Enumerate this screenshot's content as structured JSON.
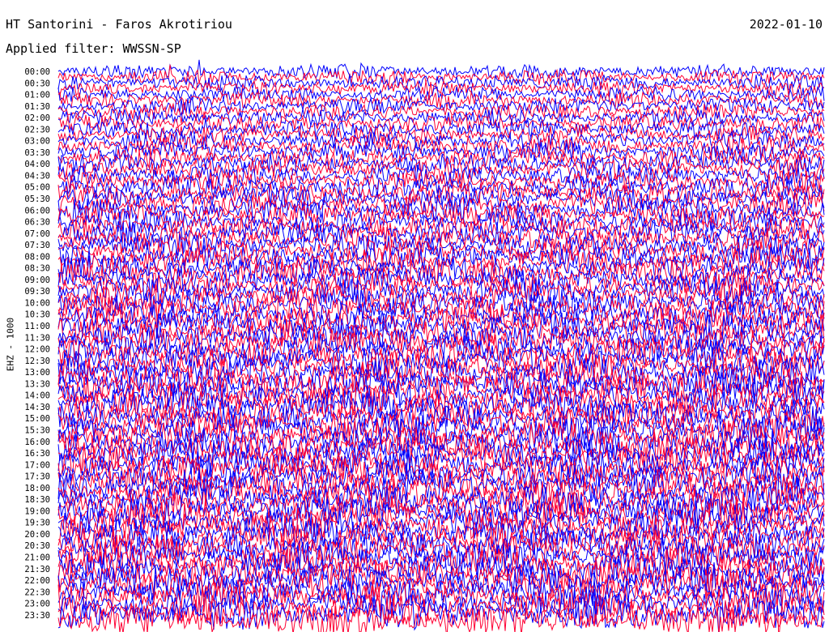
{
  "header": {
    "station": "HT Santorini - Faros Akrotiriou",
    "date": "2022-01-10",
    "filter_line": "Applied filter: WWSSN-SP"
  },
  "chart_data": {
    "type": "line",
    "subtype": "helicorder",
    "title": "HT Santorini - Faros Akrotiriou",
    "date": "2022-01-10",
    "filter": "WWSSN-SP",
    "ylabel": "EHZ - 1000",
    "y_ticks": [
      "00:00",
      "00:30",
      "01:00",
      "01:30",
      "02:00",
      "02:30",
      "03:00",
      "03:30",
      "04:00",
      "04:30",
      "05:00",
      "05:30",
      "06:00",
      "06:30",
      "07:00",
      "07:30",
      "08:00",
      "08:30",
      "09:00",
      "09:30",
      "10:00",
      "10:30",
      "11:00",
      "11:30",
      "12:00",
      "12:30",
      "13:00",
      "13:30",
      "14:00",
      "14:30",
      "15:00",
      "15:30",
      "16:00",
      "16:30",
      "17:00",
      "17:30",
      "18:00",
      "18:30",
      "19:00",
      "19:30",
      "20:00",
      "20:30",
      "21:00",
      "21:30",
      "22:00",
      "22:30",
      "23:00",
      "23:30"
    ],
    "trace_interval_minutes": 15,
    "trace_colors": [
      "#0000ff",
      "#ff0033"
    ],
    "relative_amplitude": [
      0.35,
      0.38,
      0.4,
      0.42,
      0.45,
      0.5,
      0.55,
      0.58,
      0.6,
      0.62,
      0.65,
      0.68,
      0.7,
      0.72,
      0.74,
      0.76,
      0.78,
      0.8,
      0.82,
      0.84,
      0.86,
      0.88,
      0.9,
      0.92,
      0.94,
      0.95,
      0.96,
      0.97,
      0.98,
      0.99,
      1.0,
      1.0,
      1.0,
      1.0,
      1.0,
      1.0,
      1.0,
      1.0,
      1.0,
      1.0,
      1.0,
      1.0,
      1.0,
      1.0,
      1.0,
      1.0,
      1.0,
      1.0
    ],
    "grid": false,
    "legend": "none"
  }
}
